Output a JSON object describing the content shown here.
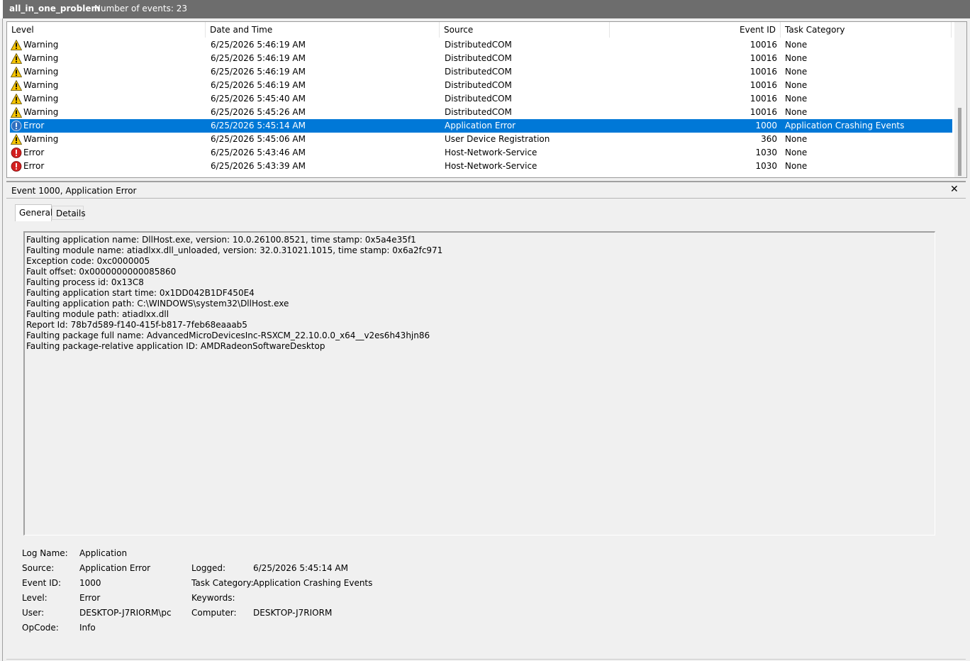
{
  "titlebar": {
    "log_name": "all_in_one_problem",
    "count_text": "Number of events: 23"
  },
  "grid": {
    "columns": [
      "Level",
      "Date and Time",
      "Source",
      "Event ID",
      "Task Category"
    ],
    "rows": [
      {
        "icon": "warning-icon",
        "level": "Warning",
        "date": "6/25/2026 5:46:19 AM",
        "source": "DistributedCOM",
        "event_id": "10016",
        "category": "None"
      },
      {
        "icon": "warning-icon",
        "level": "Warning",
        "date": "6/25/2026 5:46:19 AM",
        "source": "DistributedCOM",
        "event_id": "10016",
        "category": "None"
      },
      {
        "icon": "warning-icon",
        "level": "Warning",
        "date": "6/25/2026 5:46:19 AM",
        "source": "DistributedCOM",
        "event_id": "10016",
        "category": "None"
      },
      {
        "icon": "warning-icon",
        "level": "Warning",
        "date": "6/25/2026 5:46:19 AM",
        "source": "DistributedCOM",
        "event_id": "10016",
        "category": "None"
      },
      {
        "icon": "warning-icon",
        "level": "Warning",
        "date": "6/25/2026 5:45:40 AM",
        "source": "DistributedCOM",
        "event_id": "10016",
        "category": "None"
      },
      {
        "icon": "warning-icon",
        "level": "Warning",
        "date": "6/25/2026 5:45:26 AM",
        "source": "DistributedCOM",
        "event_id": "10016",
        "category": "None"
      },
      {
        "icon": "error-icon",
        "level": "Error",
        "date": "6/25/2026 5:45:14 AM",
        "source": "Application Error",
        "event_id": "1000",
        "category": "Application Crashing Events",
        "selected": true
      },
      {
        "icon": "warning-icon",
        "level": "Warning",
        "date": "6/25/2026 5:45:06 AM",
        "source": "User Device Registration",
        "event_id": "360",
        "category": "None"
      },
      {
        "icon": "error-icon",
        "level": "Error",
        "date": "6/25/2026 5:43:46 AM",
        "source": "Host-Network-Service",
        "event_id": "1030",
        "category": "None"
      },
      {
        "icon": "error-icon",
        "level": "Error",
        "date": "6/25/2026 5:43:39 AM",
        "source": "Host-Network-Service",
        "event_id": "1030",
        "category": "None"
      }
    ]
  },
  "detail": {
    "title": "Event 1000, Application Error",
    "close": "✕",
    "tabs": [
      "General",
      "Details"
    ],
    "description": [
      "Faulting application name: DllHost.exe, version: 10.0.26100.8521, time stamp: 0x5a4e35f1",
      "Faulting module name: atiadlxx.dll_unloaded, version: 32.0.31021.1015, time stamp: 0x6a2fc971",
      "Exception code: 0xc0000005",
      "Fault offset: 0x0000000000085860",
      "Faulting process id: 0x13C8",
      "Faulting application start time: 0x1DD042B1DF450E4",
      "Faulting application path: C:\\WINDOWS\\system32\\DllHost.exe",
      "Faulting module path: atiadlxx.dll",
      "Report Id: 78b7d589-f140-415f-b817-7feb68eaaab5",
      "Faulting package full name: AdvancedMicroDevicesInc-RSXCM_22.10.0.0_x64__v2es6h43hjn86",
      "Faulting package-relative application ID: AMDRadeonSoftwareDesktop"
    ],
    "props": {
      "log_name_label": "Log Name:",
      "log_name": "Application",
      "source_label": "Source:",
      "source": "Application Error",
      "logged_label": "Logged:",
      "logged": "6/25/2026 5:45:14 AM",
      "event_id_label": "Event ID:",
      "event_id": "1000",
      "task_category_label": "Task Category:",
      "task_category": "Application Crashing Events",
      "level_label": "Level:",
      "level": "Error",
      "keywords_label": "Keywords:",
      "user_label": "User:",
      "user": "DESKTOP-J7RIORM\\pc",
      "computer_label": "Computer:",
      "computer": "DESKTOP-J7RIORM",
      "opcode_label": "OpCode:",
      "opcode": "Info"
    }
  },
  "colors": {
    "selection": "#0078d7",
    "titlebar": "#6d6d6d",
    "warning": "#f7c400",
    "error": "#d32020",
    "info_selected": "#2f6fc0"
  }
}
